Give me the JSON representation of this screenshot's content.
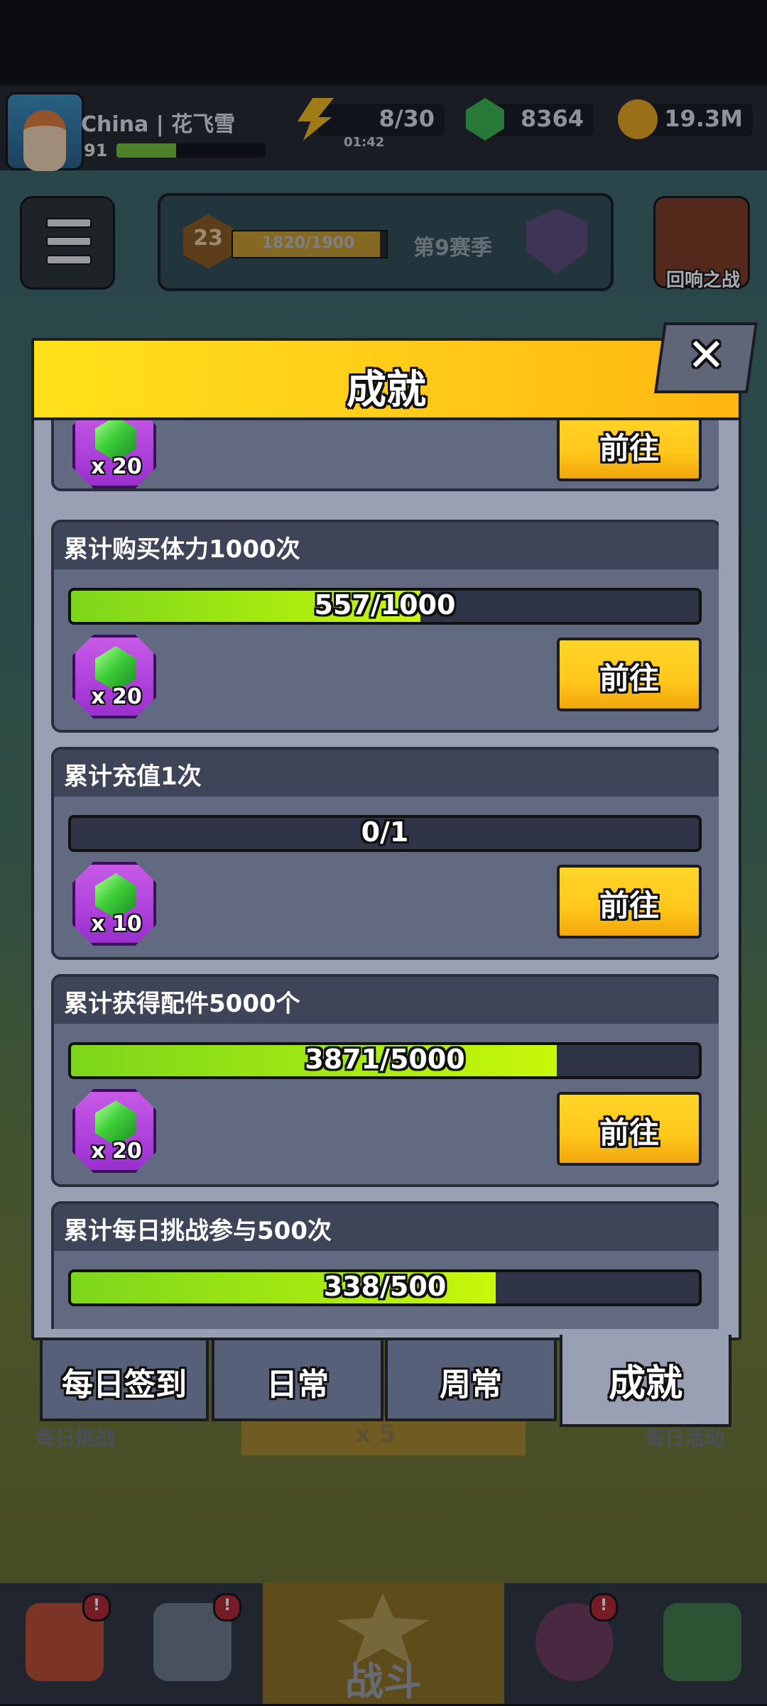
{
  "player": {
    "name": "China | 花飞雪",
    "level": "91",
    "xp_fraction": 0.4
  },
  "resources": {
    "stamina": "8/30",
    "stamina_timer": "01:42",
    "gems": "8364",
    "coins": "19.3M"
  },
  "season": {
    "level": "23",
    "progress": "1820/1900",
    "progress_fraction": 0.958,
    "name": "第9赛季"
  },
  "echo_battle_label": "回响之战",
  "modal": {
    "title": "成就",
    "close_label": "✕",
    "go_label": "前往"
  },
  "achievements": [
    {
      "title": "",
      "progress": "",
      "fill": 0,
      "reward_qty": "x 20"
    },
    {
      "title": "累计购买体力1000次",
      "progress": "557/1000",
      "fill": 0.557,
      "reward_qty": "x 20"
    },
    {
      "title": "累计充值1次",
      "progress": "0/1",
      "fill": 0,
      "reward_qty": "x 10"
    },
    {
      "title": "累计获得配件5000个",
      "progress": "3871/5000",
      "fill": 0.7742,
      "reward_qty": "x 20"
    },
    {
      "title": "累计每日挑战参与500次",
      "progress": "338/500",
      "fill": 0.676,
      "reward_qty": ""
    }
  ],
  "tabs": [
    "每日签到",
    "日常",
    "周常",
    "成就"
  ],
  "active_tab": "成就",
  "background": {
    "daily_challenge": "每日挑战",
    "daily_event": "每日活动",
    "battle": "战斗",
    "multiplier": "x 5"
  },
  "colors": {
    "header_yellow": "#ffd11a",
    "progress_green": "#9be612",
    "panel": "#9aa0b3",
    "reward_purple": "#b044e0"
  }
}
